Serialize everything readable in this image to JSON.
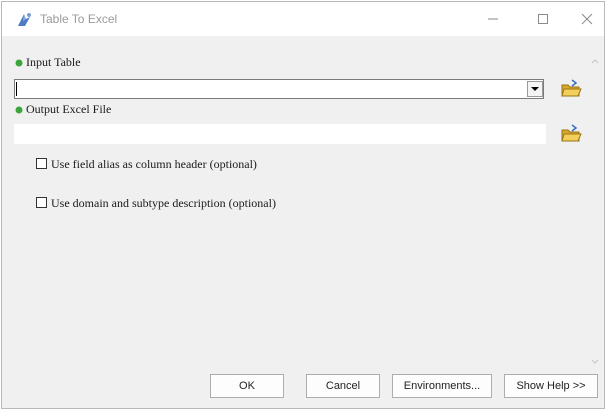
{
  "window": {
    "title": "Table To Excel",
    "icon": "arcgis-tool-icon"
  },
  "params": {
    "input_table": {
      "label": "Input Table",
      "value": ""
    },
    "output_excel": {
      "label": "Output Excel File",
      "value": ""
    },
    "use_alias": {
      "label": "Use field alias as column header (optional)",
      "checked": false
    },
    "use_domain": {
      "label": "Use domain and subtype description (optional)",
      "checked": false
    }
  },
  "buttons": {
    "ok": "OK",
    "cancel": "Cancel",
    "environments": "Environments...",
    "show_help": "Show Help >>"
  },
  "colors": {
    "required_dot": "#3aa53a",
    "folder": "#e0b43a"
  }
}
